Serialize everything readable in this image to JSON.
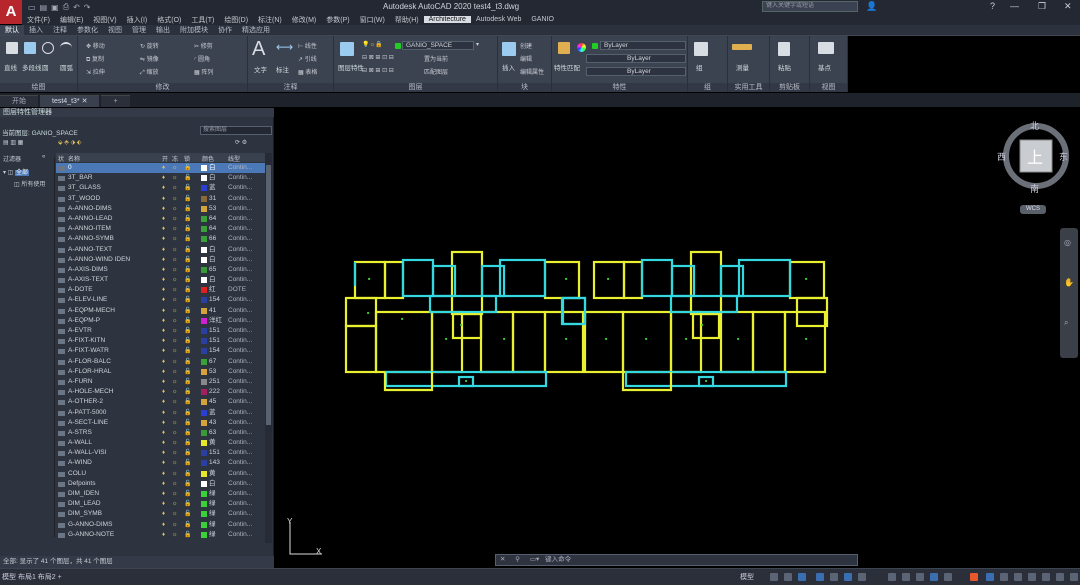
{
  "app": {
    "logo": "A",
    "title": "Autodesk AutoCAD 2020    test4_t3.dwg",
    "search_placeholder": "键入关键字或短语",
    "quick_access": [
      "□",
      "▭",
      "↶",
      "↷"
    ]
  },
  "menubar": [
    "文件(F)",
    "编辑(E)",
    "视图(V)",
    "插入(I)",
    "格式(O)",
    "工具(T)",
    "绘图(D)",
    "标注(N)",
    "修改(M)",
    "参数(P)",
    "窗口(W)",
    "帮助(H)",
    "Architecture",
    "Autodesk Web",
    "GANIO"
  ],
  "menubar_active": "Architecture",
  "ribbon_tabs": [
    "默认",
    "插入",
    "注释",
    "参数化",
    "视图",
    "管理",
    "输出",
    "附加模块",
    "协作",
    "精选应用"
  ],
  "ribbon": {
    "panels": [
      "绘图",
      "修改",
      "注释",
      "图层",
      "块",
      "特性",
      "组",
      "实用工具",
      "剪贴板",
      "视图"
    ],
    "draw_tools": [
      "直线",
      "多段线",
      "圆",
      "圆弧"
    ],
    "modify_tools": [
      "移动",
      "旋转",
      "修剪",
      "复制",
      "镜像",
      "圆角",
      "拉伸",
      "缩放",
      "阵列"
    ],
    "annotation_tools": [
      "文字",
      "标注",
      "线性",
      "引线",
      "表格"
    ],
    "layer_props_label": "图层特性",
    "layer_current": "GANIO_SPACE",
    "layer_tools": [
      "置为当前",
      "匹配图层"
    ],
    "block_tools": [
      "插入",
      "创建",
      "编辑",
      "编辑属性"
    ],
    "properties_tools": [
      "特性匹配"
    ],
    "bylayer": [
      "ByLayer",
      "ByLayer",
      "ByLayer"
    ],
    "group_tools": [
      "组"
    ],
    "utility_tools": [
      "测量"
    ],
    "clipboard_tools": [
      "粘贴"
    ],
    "view_tools": [
      "基点"
    ]
  },
  "doc_tabs": [
    "开始",
    "test4_t3*"
  ],
  "layer_panel": {
    "title": "图层特性管理器",
    "current_layer_label": "当前图层: GANIO_SPACE",
    "search_placeholder": "搜索图层",
    "filter_header": "过滤器",
    "tree_items": [
      "全部",
      "所有使用"
    ],
    "columns": [
      "状",
      "名称",
      "开",
      "冻",
      "锁",
      "颜色",
      "线型"
    ],
    "status_text": "全部: 显示了 41 个图层，共 41 个图层",
    "rows": [
      {
        "name": "0",
        "color": "#ffffff",
        "cn": "白",
        "lt": "Contin..."
      },
      {
        "name": "3T_BAR",
        "color": "#ffffff",
        "cn": "白",
        "lt": "Contin..."
      },
      {
        "name": "3T_GLASS",
        "color": "#2a3fd0",
        "cn": "蓝",
        "lt": "Contin..."
      },
      {
        "name": "3T_WOOD",
        "color": "#8a6a3a",
        "cn": "31",
        "lt": "Contin..."
      },
      {
        "name": "A-ANNO-DIMS",
        "color": "#d4a43a",
        "cn": "53",
        "lt": "Contin..."
      },
      {
        "name": "A-ANNO-LEAD",
        "color": "#3aa03a",
        "cn": "64",
        "lt": "Contin..."
      },
      {
        "name": "A-ANNO-ITEM",
        "color": "#3aa03a",
        "cn": "64",
        "lt": "Contin..."
      },
      {
        "name": "A-ANNO-SYMB",
        "color": "#3aa03a",
        "cn": "66",
        "lt": "Contin..."
      },
      {
        "name": "A-ANNO-TEXT",
        "color": "#ffffff",
        "cn": "白",
        "lt": "Contin..."
      },
      {
        "name": "A-ANNO-WIND IDEN",
        "color": "#ffffff",
        "cn": "白",
        "lt": "Contin..."
      },
      {
        "name": "A-AXIS-DIMS",
        "color": "#3a9a3a",
        "cn": "65",
        "lt": "Contin..."
      },
      {
        "name": "A-AXIS-TEXT",
        "color": "#ffffff",
        "cn": "白",
        "lt": "Contin..."
      },
      {
        "name": "A-DOTE",
        "color": "#e02020",
        "cn": "红",
        "lt": "DOTE"
      },
      {
        "name": "A-ELEV-LINE",
        "color": "#2a3fa0",
        "cn": "154",
        "lt": "Contin..."
      },
      {
        "name": "A-EQPM-MECH",
        "color": "#d4a43a",
        "cn": "41",
        "lt": "Contin..."
      },
      {
        "name": "A-EQPM-P",
        "color": "#d020d0",
        "cn": "洋红",
        "lt": "Contin..."
      },
      {
        "name": "A-EVTR",
        "color": "#2a3fa0",
        "cn": "151",
        "lt": "Contin..."
      },
      {
        "name": "A-FIXT-KITN",
        "color": "#2a3fa0",
        "cn": "151",
        "lt": "Contin..."
      },
      {
        "name": "A-FIXT-WATR",
        "color": "#2a3fa0",
        "cn": "154",
        "lt": "Contin..."
      },
      {
        "name": "A-FLOR-BALC",
        "color": "#3aa03a",
        "cn": "67",
        "lt": "Contin..."
      },
      {
        "name": "A-FLOR-HRAL",
        "color": "#d4a43a",
        "cn": "53",
        "lt": "Contin..."
      },
      {
        "name": "A-FURN",
        "color": "#888888",
        "cn": "251",
        "lt": "Contin..."
      },
      {
        "name": "A-HOLE-MECH",
        "color": "#a02060",
        "cn": "222",
        "lt": "Contin..."
      },
      {
        "name": "A-OTHER-2",
        "color": "#d4a43a",
        "cn": "45",
        "lt": "Contin..."
      },
      {
        "name": "A-PATT-5000",
        "color": "#2a3fd0",
        "cn": "蓝",
        "lt": "Contin..."
      },
      {
        "name": "A-SECT-LINE",
        "color": "#d4a43a",
        "cn": "43",
        "lt": "Contin..."
      },
      {
        "name": "A-STRS",
        "color": "#3a9a3a",
        "cn": "63",
        "lt": "Contin..."
      },
      {
        "name": "A-WALL",
        "color": "#e6e62a",
        "cn": "黄",
        "lt": "Contin..."
      },
      {
        "name": "A-WALL-VISI",
        "color": "#2a3fa0",
        "cn": "151",
        "lt": "Contin..."
      },
      {
        "name": "A-WIND",
        "color": "#2a3fa0",
        "cn": "143",
        "lt": "Contin..."
      },
      {
        "name": "COLU",
        "color": "#e6e62a",
        "cn": "黄",
        "lt": "Contin..."
      },
      {
        "name": "Defpoints",
        "color": "#ffffff",
        "cn": "白",
        "lt": "Contin..."
      },
      {
        "name": "DIM_IDEN",
        "color": "#3ad03a",
        "cn": "绿",
        "lt": "Contin..."
      },
      {
        "name": "DIM_LEAD",
        "color": "#3ad03a",
        "cn": "绿",
        "lt": "Contin..."
      },
      {
        "name": "DIM_SYMB",
        "color": "#3ad03a",
        "cn": "绿",
        "lt": "Contin..."
      },
      {
        "name": "G-ANNO-DIMS",
        "color": "#3ad03a",
        "cn": "绿",
        "lt": "Contin..."
      },
      {
        "name": "G-ANNO-NOTE",
        "color": "#3ad03a",
        "cn": "绿",
        "lt": "Contin..."
      }
    ]
  },
  "viewcube": {
    "north": "北",
    "south": "南",
    "east": "东",
    "west": "西",
    "top": "上",
    "wcs": "WCS"
  },
  "command": {
    "placeholder": "键入命令"
  },
  "ucs": {
    "x": "X",
    "y": "Y"
  },
  "statusbar": {
    "tabs": "模型  布局1  布局2  +",
    "model": "模型"
  },
  "colors": {
    "wall_yellow": "#e8f030",
    "wall_cyan": "#33d8e0",
    "accent": "#4b79b8"
  }
}
